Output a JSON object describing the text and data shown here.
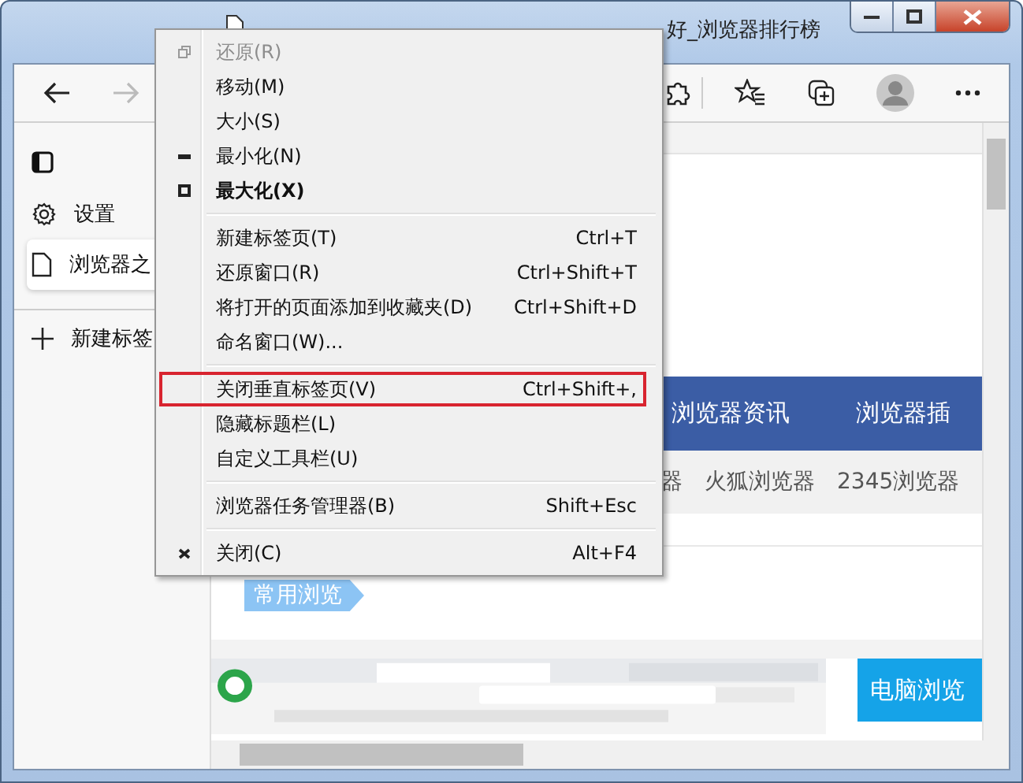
{
  "window": {
    "title": "好_浏览器排行榜"
  },
  "toolbar": {
    "back_enabled": true,
    "forward_enabled": false
  },
  "sidebar": {
    "items": [
      {
        "kind": "action",
        "label": "设置",
        "selected": false
      },
      {
        "kind": "tab",
        "label": "浏览器之",
        "selected": true
      },
      {
        "kind": "new",
        "label": "新建标签",
        "selected": false
      }
    ]
  },
  "page": {
    "nav": [
      "浏览器资讯",
      "浏览器插"
    ],
    "subnav": [
      "器",
      "火狐浏览器",
      "2345浏览器"
    ],
    "section_tag": "常用浏览",
    "feature_label": "电脑浏览"
  },
  "context_menu": {
    "items": [
      {
        "kind": "restore",
        "label": "还原(R)",
        "disabled": true,
        "default": false,
        "highlighted": false
      },
      {
        "kind": "item",
        "label": "移动(M)",
        "disabled": false,
        "default": false,
        "highlighted": false
      },
      {
        "kind": "item",
        "label": "大小(S)",
        "disabled": false,
        "default": false,
        "highlighted": false
      },
      {
        "kind": "minimize",
        "label": "最小化(N)",
        "disabled": false,
        "default": false,
        "highlighted": false
      },
      {
        "kind": "maximize",
        "label": "最大化(X)",
        "disabled": false,
        "default": true,
        "highlighted": false
      },
      {
        "kind": "separator"
      },
      {
        "kind": "item",
        "label": "新建标签页(T)",
        "shortcut": "Ctrl+T",
        "disabled": false,
        "default": false,
        "highlighted": false
      },
      {
        "kind": "item",
        "label": "还原窗口(R)",
        "shortcut": "Ctrl+Shift+T",
        "disabled": false,
        "default": false,
        "highlighted": false
      },
      {
        "kind": "item",
        "label": "将打开的页面添加到收藏夹(D)",
        "shortcut": "Ctrl+Shift+D",
        "disabled": false,
        "default": false,
        "highlighted": false
      },
      {
        "kind": "item",
        "label": "命名窗口(W)...",
        "disabled": false,
        "default": false,
        "highlighted": false
      },
      {
        "kind": "separator"
      },
      {
        "kind": "item",
        "label": "关闭垂直标签页(V)",
        "shortcut": "Ctrl+Shift+,",
        "disabled": false,
        "default": false,
        "highlighted": true
      },
      {
        "kind": "item",
        "label": "隐藏标题栏(L)",
        "disabled": false,
        "default": false,
        "highlighted": false
      },
      {
        "kind": "item",
        "label": "自定义工具栏(U)",
        "disabled": false,
        "default": false,
        "highlighted": false
      },
      {
        "kind": "separator"
      },
      {
        "kind": "item",
        "label": "浏览器任务管理器(B)",
        "shortcut": "Shift+Esc",
        "disabled": false,
        "default": false,
        "highlighted": false
      },
      {
        "kind": "separator"
      },
      {
        "kind": "close",
        "label": "关闭(C)",
        "shortcut": "Alt+F4",
        "disabled": false,
        "default": false,
        "highlighted": false
      }
    ]
  }
}
